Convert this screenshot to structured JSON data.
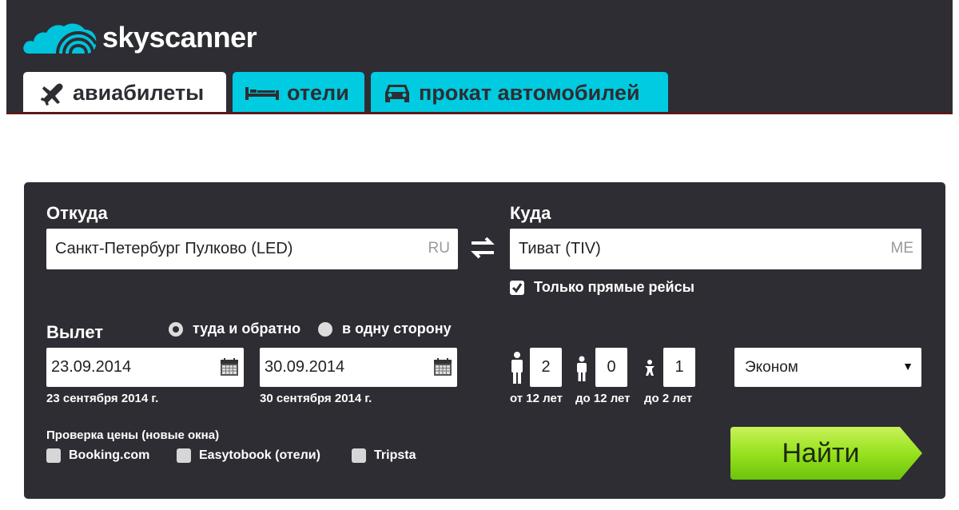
{
  "brand": {
    "name": "skyscanner"
  },
  "tabs": [
    {
      "label": "авиабилеты",
      "icon": "plane-icon",
      "active": true
    },
    {
      "label": "отели",
      "icon": "bed-icon",
      "active": false
    },
    {
      "label": "прокат автомобилей",
      "icon": "car-icon",
      "active": false
    }
  ],
  "search": {
    "from_label": "Откуда",
    "from_value": "Санкт-Петербург Пулково (LED)",
    "from_code": "RU",
    "to_label": "Куда",
    "to_value": "Тиват (TIV)",
    "to_code": "ME",
    "direct_only_label": "Только прямые рейсы",
    "direct_only_checked": true,
    "depart_label": "Вылет",
    "trip_types": [
      {
        "label": "туда и обратно",
        "selected": true
      },
      {
        "label": "в одну сторону",
        "selected": false
      }
    ],
    "depart_date": "23.09.2014",
    "depart_date_text": "23 сентября 2014 г.",
    "return_date": "30.09.2014",
    "return_date_text": "30 сентября 2014 г.",
    "passengers": [
      {
        "icon": "adult-icon",
        "count": "2",
        "label": "от 12 лет"
      },
      {
        "icon": "child-icon",
        "count": "0",
        "label": "до 12 лет"
      },
      {
        "icon": "infant-icon",
        "count": "1",
        "label": "до 2 лет"
      }
    ],
    "cabin_class": "Эконом",
    "price_check_label": "Проверка цены (новые окна)",
    "partners": [
      {
        "label": "Booking.com",
        "checked": false
      },
      {
        "label": "Easytobook (отели)",
        "checked": false
      },
      {
        "label": "Tripsta",
        "checked": false
      }
    ],
    "submit_label": "Найти"
  },
  "colors": {
    "header_bg": "#2e2d33",
    "tab_inactive": "#00cbe0",
    "logo_cyan": "#00c3dc",
    "button_green": "#8fdc1a"
  }
}
